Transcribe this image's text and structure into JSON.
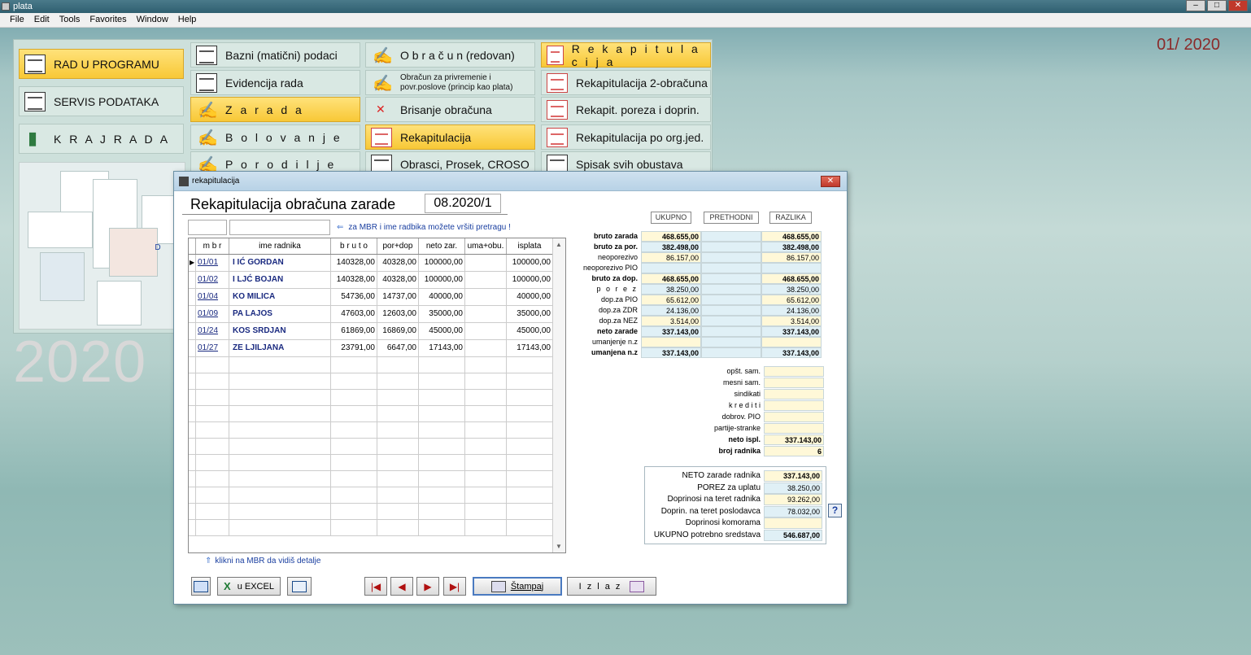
{
  "app": {
    "title": "plata",
    "menu": [
      "File",
      "Edit",
      "Tools",
      "Favorites",
      "Window",
      "Help"
    ],
    "period": "01/ 2020",
    "year_watermark": "2020"
  },
  "launcher": {
    "main": [
      {
        "label": "RAD  U  PROGRAMU",
        "active": true
      },
      {
        "label": "SERVIS PODATAKA"
      },
      {
        "label": "K R A J   R A D A"
      }
    ],
    "col1": [
      {
        "label": "Bazni (matični) podaci"
      },
      {
        "label": "Evidencija rada"
      },
      {
        "label": "Z a r a d a",
        "active": true
      },
      {
        "label": "B o l o v a n j e"
      },
      {
        "label": "P o r o d i l j e"
      }
    ],
    "col2": [
      {
        "label": "O b r a č u n   (redovan)"
      },
      {
        "label": "Obračun za privremenie i povr.poslove (princip kao plata)"
      },
      {
        "label": "Brisanje obračuna"
      },
      {
        "label": "Rekapitulacija",
        "active": true
      },
      {
        "label": "Obrasci, Prosek, CROSO"
      }
    ],
    "col3": [
      {
        "label": "R e k a p i t u l a c i j a",
        "active": true
      },
      {
        "label": "Rekapitulacija  2-obračuna"
      },
      {
        "label": "Rekapit. poreza i doprin."
      },
      {
        "label": "Rekapitulacija po org.jed."
      },
      {
        "label": "Spisak svih obustava"
      }
    ],
    "illus_letter": "D"
  },
  "dialog": {
    "window_title": "rekapitulacija",
    "heading": "Rekapitulacija obračuna zarade",
    "period": "08.2020/1",
    "search_hint": "za MBR i ime radbika možete vršiti pretragu !",
    "grid_note": "klikni na MBR da vidiš detalje",
    "columns": [
      "m b r",
      "ime radnika",
      "b r u t o",
      "por+dop",
      "neto zar.",
      "uma+obu.",
      "isplata"
    ],
    "rows": [
      {
        "mbr": "01/01",
        "name": "I     IĆ GORDAN",
        "bruto": "140328,00",
        "pordop": "40328,00",
        "neto": "100000,00",
        "uma": "",
        "isplata": "100000,00"
      },
      {
        "mbr": "01/02",
        "name": "I    LJĆ BOJAN",
        "bruto": "140328,00",
        "pordop": "40328,00",
        "neto": "100000,00",
        "uma": "",
        "isplata": "100000,00"
      },
      {
        "mbr": "01/04",
        "name": "KO       MILICA",
        "bruto": "54736,00",
        "pordop": "14737,00",
        "neto": "40000,00",
        "uma": "",
        "isplata": "40000,00"
      },
      {
        "mbr": "01/09",
        "name": "PA           LAJOS",
        "bruto": "47603,00",
        "pordop": "12603,00",
        "neto": "35000,00",
        "uma": "",
        "isplata": "35000,00"
      },
      {
        "mbr": "01/24",
        "name": "KOS          SRDJAN",
        "bruto": "61869,00",
        "pordop": "16869,00",
        "neto": "45000,00",
        "uma": "",
        "isplata": "45000,00"
      },
      {
        "mbr": "01/27",
        "name": "ZE       LJILJANA",
        "bruto": "23791,00",
        "pordop": "6647,00",
        "neto": "17143,00",
        "uma": "",
        "isplata": "17143,00"
      }
    ],
    "sum_headers": [
      "UKUPNO",
      "PRETHODNI",
      "RAZLIKA"
    ],
    "summary": [
      {
        "label": "bruto zarada",
        "ukupno": "468.655,00",
        "prethodni": "",
        "razlika": "468.655,00",
        "bold": true
      },
      {
        "label": "bruto za por.",
        "ukupno": "382.498,00",
        "prethodni": "",
        "razlika": "382.498,00",
        "bold": true
      },
      {
        "label": "neoporezivo",
        "ukupno": "86.157,00",
        "prethodni": "",
        "razlika": "86.157,00"
      },
      {
        "label": "neoporezivo PIO",
        "ukupno": "",
        "prethodni": "",
        "razlika": ""
      },
      {
        "label": "bruto za dop.",
        "ukupno": "468.655,00",
        "prethodni": "",
        "razlika": "468.655,00",
        "bold": true
      },
      {
        "label": "p o r e z",
        "ukupno": "38.250,00",
        "prethodni": "",
        "razlika": "38.250,00"
      },
      {
        "label": "dop.za PIO",
        "ukupno": "65.612,00",
        "prethodni": "",
        "razlika": "65.612,00"
      },
      {
        "label": "dop.za ZDR",
        "ukupno": "24.136,00",
        "prethodni": "",
        "razlika": "24.136,00"
      },
      {
        "label": "dop.za NEZ",
        "ukupno": "3.514,00",
        "prethodni": "",
        "razlika": "3.514,00"
      },
      {
        "label": "neto zarade",
        "ukupno": "337.143,00",
        "prethodni": "",
        "razlika": "337.143,00",
        "bold": true
      },
      {
        "label": "umanjenje n.z",
        "ukupno": "",
        "prethodni": "",
        "razlika": ""
      },
      {
        "label": "umanjena n.z",
        "ukupno": "337.143,00",
        "prethodni": "",
        "razlika": "337.143,00",
        "bold": true
      }
    ],
    "deductions": [
      {
        "label": "opšt. sam.",
        "value": ""
      },
      {
        "label": "mesni sam.",
        "value": ""
      },
      {
        "label": "sindikati",
        "value": ""
      },
      {
        "label": "k r e d i t i",
        "value": ""
      },
      {
        "label": "dobrov. PIO",
        "value": ""
      },
      {
        "label": "partije-stranke",
        "value": ""
      },
      {
        "label": "neto ispl.",
        "value": "337.143,00",
        "bold": true
      },
      {
        "label": "broj radnika",
        "value": "6",
        "bold": true
      }
    ],
    "totals": [
      {
        "label": "NETO zarade radnika",
        "value": "337.143,00",
        "bold": true
      },
      {
        "label": "POREZ za uplatu",
        "value": "38.250,00"
      },
      {
        "label": "Doprinosi na teret radnika",
        "value": "93.262,00"
      },
      {
        "label": "Doprin. na teret poslodavca",
        "value": "78.032,00"
      },
      {
        "label": "Doprinosi komorama",
        "value": ""
      },
      {
        "label": "UKUPNO potrebno sredstava",
        "value": "546.687,00",
        "bold": true
      }
    ],
    "buttons": {
      "excel": "u EXCEL",
      "print": "Štampaj",
      "exit": "I z l a z",
      "first": "|◀",
      "prev": "◀",
      "next": "▶",
      "last": "▶|",
      "help": "?"
    }
  }
}
